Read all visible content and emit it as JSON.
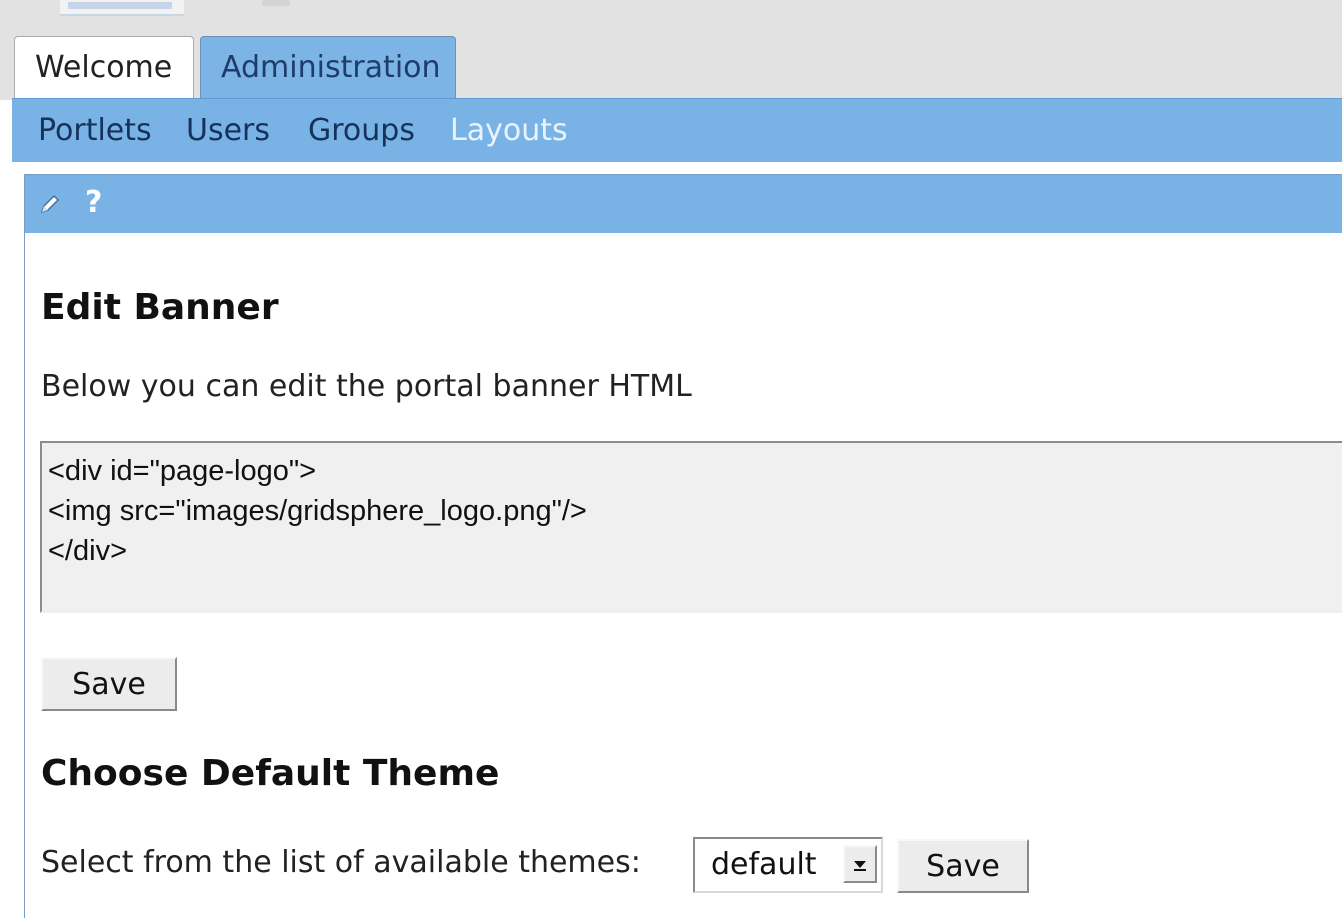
{
  "tabs": [
    {
      "label": "Welcome",
      "active": false
    },
    {
      "label": "Administration",
      "active": true
    }
  ],
  "subnav": {
    "items": [
      {
        "label": "Portlets",
        "active": false
      },
      {
        "label": "Users",
        "active": false
      },
      {
        "label": "Groups",
        "active": false
      },
      {
        "label": "Layouts",
        "active": true
      }
    ]
  },
  "portlet": {
    "toolbar": {
      "edit_icon": "pencil-icon",
      "help_label": "?"
    },
    "banner": {
      "heading": "Edit Banner",
      "description": "Below you can edit the portal banner HTML",
      "html_value": "<div id=\"page-logo\">\n<img src=\"images/gridsphere_logo.png\"/>\n</div>",
      "save_label": "Save"
    },
    "theme": {
      "heading": "Choose Default Theme",
      "description": "Select from the list of available themes:",
      "selected": "default",
      "save_label": "Save"
    }
  },
  "colors": {
    "bar_blue": "#79b3e6",
    "active_subnav_text": "#eaf3fc",
    "subnav_text": "#15325a"
  }
}
